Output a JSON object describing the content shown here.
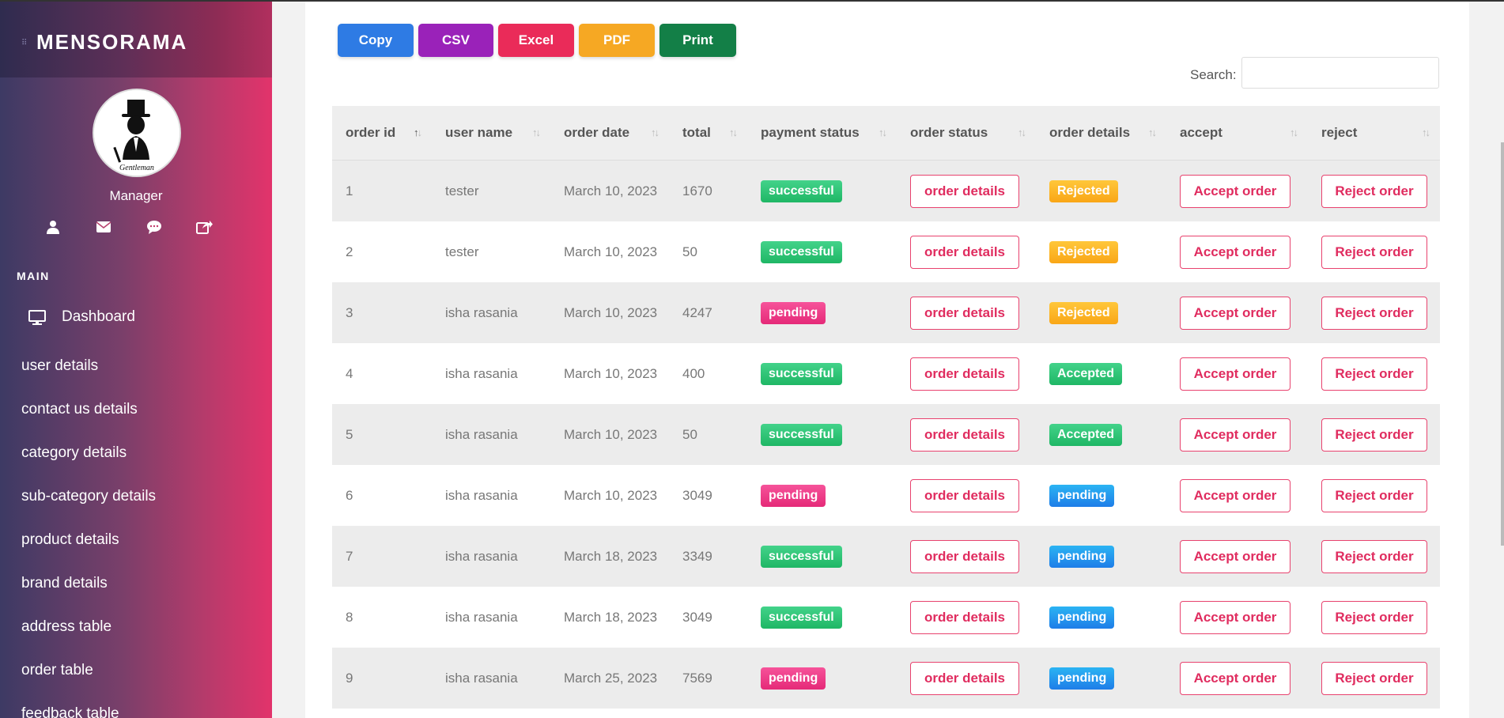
{
  "sidebar": {
    "brand": "MENSORAMA",
    "role": "Manager",
    "section_title": "MAIN",
    "quick_icons": [
      "user-icon",
      "envelope-icon",
      "chat-icon",
      "share-icon"
    ],
    "items": [
      {
        "label": "Dashboard",
        "icon": "monitor-icon"
      },
      {
        "label": "user details"
      },
      {
        "label": "contact us details"
      },
      {
        "label": "category details"
      },
      {
        "label": "sub-category details"
      },
      {
        "label": "product details"
      },
      {
        "label": "brand details"
      },
      {
        "label": "address table"
      },
      {
        "label": "order table"
      },
      {
        "label": "feedback table"
      }
    ]
  },
  "export_buttons": [
    {
      "label": "Copy",
      "color": "#2e7be4"
    },
    {
      "label": "CSV",
      "color": "#9a22b9"
    },
    {
      "label": "Excel",
      "color": "#ea2b59"
    },
    {
      "label": "PDF",
      "color": "#f6a823"
    },
    {
      "label": "Print",
      "color": "#137f47"
    }
  ],
  "search": {
    "label": "Search:",
    "placeholder": "",
    "value": ""
  },
  "table": {
    "columns": [
      "order id",
      "user name",
      "order date",
      "total",
      "payment status",
      "order status",
      "order details",
      "accept",
      "reject"
    ],
    "order_status_button": "order details",
    "accept_button": "Accept order",
    "reject_button": "Reject order",
    "rows": [
      {
        "id": "1",
        "user": "tester",
        "date": "March 10, 2023",
        "total": "1670",
        "payment": "successful",
        "details": "Rejected"
      },
      {
        "id": "2",
        "user": "tester",
        "date": "March 10, 2023",
        "total": "50",
        "payment": "successful",
        "details": "Rejected"
      },
      {
        "id": "3",
        "user": "isha rasania",
        "date": "March 10, 2023",
        "total": "4247",
        "payment": "pending",
        "details": "Rejected"
      },
      {
        "id": "4",
        "user": "isha rasania",
        "date": "March 10, 2023",
        "total": "400",
        "payment": "successful",
        "details": "Accepted"
      },
      {
        "id": "5",
        "user": "isha rasania",
        "date": "March 10, 2023",
        "total": "50",
        "payment": "successful",
        "details": "Accepted"
      },
      {
        "id": "6",
        "user": "isha rasania",
        "date": "March 10, 2023",
        "total": "3049",
        "payment": "pending",
        "details": "pending"
      },
      {
        "id": "7",
        "user": "isha rasania",
        "date": "March 18, 2023",
        "total": "3349",
        "payment": "successful",
        "details": "pending"
      },
      {
        "id": "8",
        "user": "isha rasania",
        "date": "March 18, 2023",
        "total": "3049",
        "payment": "successful",
        "details": "pending"
      },
      {
        "id": "9",
        "user": "isha rasania",
        "date": "March 25, 2023",
        "total": "7569",
        "payment": "pending",
        "details": "pending"
      }
    ]
  }
}
